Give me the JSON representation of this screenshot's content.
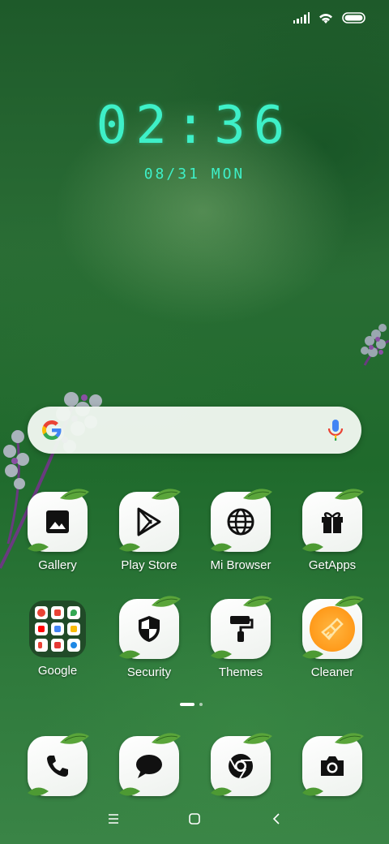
{
  "status_bar": {
    "icons": [
      "signal-icon",
      "wifi-icon",
      "battery-icon"
    ]
  },
  "lockscreen_clock": {
    "time": "02:36",
    "date": "08/31 MON"
  },
  "search": {
    "icons": [
      "google-g-icon",
      "mic-icon"
    ]
  },
  "apps": [
    {
      "label": "Gallery",
      "icon": "image-icon"
    },
    {
      "label": "Play Store",
      "icon": "play-store-icon"
    },
    {
      "label": "Mi Browser",
      "icon": "globe-icon"
    },
    {
      "label": "GetApps",
      "icon": "gift-icon"
    },
    {
      "label": "Google",
      "icon": "folder-icon"
    },
    {
      "label": "Security",
      "icon": "shield-icon"
    },
    {
      "label": "Themes",
      "icon": "paint-roller-icon"
    },
    {
      "label": "Cleaner",
      "icon": "broom-icon"
    }
  ],
  "dock": [
    {
      "icon": "phone-icon"
    },
    {
      "icon": "message-icon"
    },
    {
      "icon": "chrome-icon"
    },
    {
      "icon": "camera-icon"
    }
  ],
  "page_indicator": {
    "pages": 2,
    "current": 1
  },
  "nav_bar": {
    "icons": [
      "menu-icon",
      "home-icon",
      "back-icon"
    ]
  },
  "colors": {
    "clock": "#3ef0c8",
    "wallpaper": "#2a6d35",
    "cleaner": "#ff9a1a"
  }
}
